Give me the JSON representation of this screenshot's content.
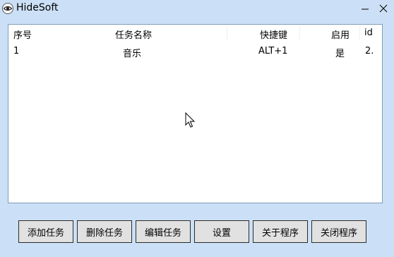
{
  "window": {
    "title": "HideSoft",
    "icon": "eye-icon",
    "controls": [
      "minimize-icon",
      "close-icon"
    ]
  },
  "table": {
    "columns": [
      "序号",
      "任务名称",
      "快捷键",
      "启用",
      "id"
    ],
    "rows": [
      {
        "index": "1",
        "name": "音乐",
        "hotkey": "ALT+1",
        "enabled": "是",
        "id": "2."
      }
    ]
  },
  "buttons": {
    "add": "添加任务",
    "delete": "删除任务",
    "edit": "编辑任务",
    "settings": "设置",
    "about": "关于程序",
    "close": "关闭程序"
  },
  "colors": {
    "window_bg": "#cbe0f6",
    "button_bg": "#e1e1e1",
    "list_bg": "#ffffff"
  }
}
